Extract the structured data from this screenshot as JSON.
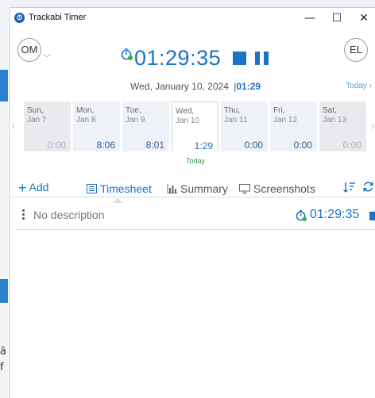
{
  "window": {
    "title": "Trackabi Timer",
    "minimize": "—",
    "maximize": "☐",
    "close": "✕"
  },
  "user": {
    "left_avatar": "OM",
    "right_avatar": "EL"
  },
  "timer": {
    "elapsed": "01:29:35"
  },
  "date_header": {
    "date": "Wed, January 10, 2024",
    "separator": "|",
    "day_total": "01:29",
    "today_link": "Today ›"
  },
  "week": {
    "days": [
      {
        "name": "Sun,",
        "date": "Jan 7",
        "total": "0:00"
      },
      {
        "name": "Mon,",
        "date": "Jan 8",
        "total": "8:06"
      },
      {
        "name": "Tue,",
        "date": "Jan 9",
        "total": "8:01"
      },
      {
        "name": "Wed,",
        "date": "Jan 10",
        "total": "1:29"
      },
      {
        "name": "Thu,",
        "date": "Jan 11",
        "total": "0:00"
      },
      {
        "name": "Fri,",
        "date": "Jan 12",
        "total": "0:00"
      },
      {
        "name": "Sat,",
        "date": "Jan 13",
        "total": "0:00"
      }
    ],
    "today_label": "Today"
  },
  "tabs": {
    "add": "Add",
    "timesheet": "Timesheet",
    "summary": "Summary",
    "screenshots": "Screenshots"
  },
  "entry": {
    "description": "No description",
    "time": "01:29:35"
  },
  "edge": {
    "char1": "ä",
    "char2": "f"
  },
  "colors": {
    "accent": "#1a73c9",
    "today_green": "#2f9a3e",
    "timer_green_dot": "#3cb043"
  }
}
